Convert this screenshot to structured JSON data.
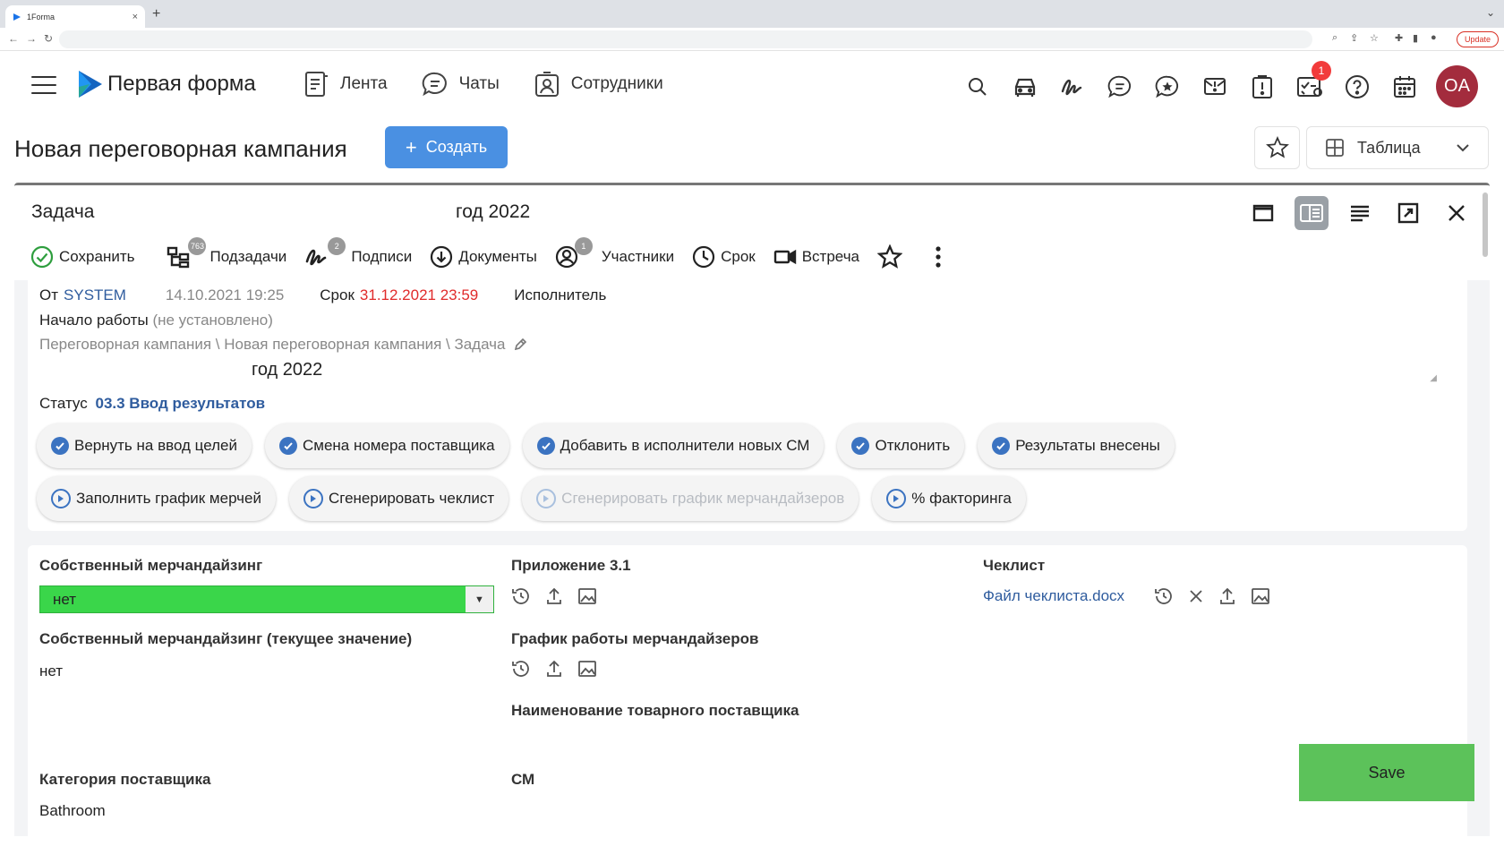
{
  "browser": {
    "tab_title": "1Forma",
    "tab_close": "×",
    "new_tab": "+",
    "update_label": "Update"
  },
  "header": {
    "logo_text": "Первая форма",
    "nav": [
      {
        "label": "Лента",
        "icon": "feed-icon"
      },
      {
        "label": "Чаты",
        "icon": "chat-icon"
      },
      {
        "label": "Сотрудники",
        "icon": "employees-icon"
      }
    ],
    "tray_icons": [
      "search-icon",
      "car-icon",
      "signature-icon",
      "messages-icon",
      "favorites-chat-icon",
      "mail-alert-icon",
      "alert-icon",
      "tasks-icon",
      "help-icon",
      "calendar-icon"
    ],
    "notification_count": "1",
    "avatar_initials": "OA"
  },
  "page": {
    "title": "Новая переговорная кампания",
    "create_label": "Создать",
    "view_label": "Таблица"
  },
  "task": {
    "title_left": "Задача",
    "title_right": "год 2022",
    "toolbar": {
      "save": "Сохранить",
      "subtasks": "Подзадачи",
      "subtasks_count": "763",
      "signatures": "Подписи",
      "signatures_count": "2",
      "documents": "Документы",
      "participants": "Участники",
      "participants_count": "1",
      "deadline": "Срок",
      "meeting": "Встреча"
    },
    "meta": {
      "from_label": "От",
      "from_value": "SYSTEM",
      "date": "14.10.2021 19:25",
      "deadline_label": "Срок",
      "deadline_value": "31.12.2021 23:59",
      "executor_label": "Исполнитель",
      "start_label": "Начало работы",
      "start_value": "(не установлено)",
      "path": "Переговорная кампания \\ Новая переговорная кампания \\ Задача",
      "description": "год 2022",
      "status_label": "Статус",
      "status_value": "03.3 Ввод результатов"
    },
    "actions_row1": [
      "Вернуть на ввод целей",
      "Смена номера поставщика",
      "Добавить в исполнители новых СМ",
      "Отклонить",
      "Результаты внесены"
    ],
    "actions_row2": [
      "Заполнить график мерчей",
      "Сгенерировать чеклист",
      "Сгенерировать график мерчандайзеров",
      "% факторинга"
    ],
    "fields": {
      "own_merch_label": "Собственный мерчандайзинг",
      "own_merch_value": "нет",
      "own_merch_current_label": "Собственный мерчандайзинг (текущее значение)",
      "own_merch_current_value": "нет",
      "supplier_category_label": "Категория поставщика",
      "supplier_category_value": "Bathroom",
      "appendix_label": "Приложение 3.1",
      "merch_schedule_label": "График работы мерчандайзеров",
      "supplier_name_label": "Наименование товарного поставщика",
      "cm_label": "СМ",
      "checklist_label": "Чеклист",
      "checklist_file": "Файл чеклиста.docx"
    },
    "save_float": "Save"
  },
  "colors": {
    "accent_blue": "#4a90e2",
    "link_blue": "#2f5c9e",
    "deadline_red": "#e02b2b",
    "select_green": "#3ad64a",
    "save_green": "#5cc25a",
    "avatar_bg": "#a32c3d",
    "badge_red": "#f23b3b"
  }
}
